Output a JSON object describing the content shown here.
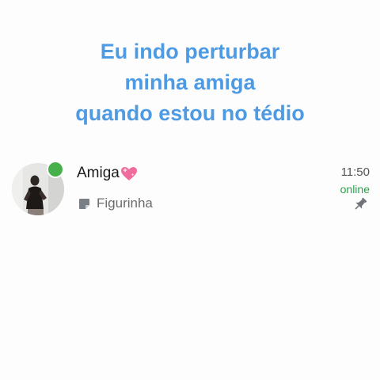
{
  "caption": {
    "lines": [
      "Eu indo perturbar",
      "minha amiga",
      "quando estou no tédio"
    ]
  },
  "chat": {
    "name": "Amiga",
    "name_emoji": "heart-icon",
    "preview_icon": "sticker-icon",
    "preview_text": "Figurinha",
    "time": "11:50",
    "status": "online",
    "pinned_icon": "pin-icon",
    "online_indicator": true
  },
  "colors": {
    "caption": "#4e9be4",
    "online_dot": "#47b04b",
    "status_text": "#2aa24c",
    "heart": "#ef6c9c"
  }
}
